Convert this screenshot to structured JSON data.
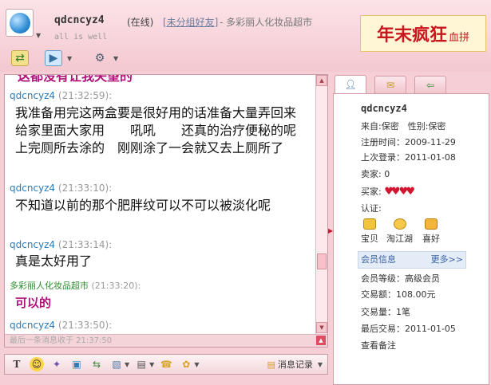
{
  "header": {
    "contact_name": "qdcncyz4",
    "status": "(在线)",
    "group": "[未分组好友]",
    "shop": "- 多彩丽人化妆品超市",
    "signature": "all is well",
    "banner_big": "年末疯狂",
    "banner_small": "血拼"
  },
  "chat": {
    "cut_text": "这都没有让我失望的",
    "messages": [
      {
        "sender": "qdcncyz4",
        "time": "(21:32:59):",
        "text": "我准备用完这两盒要是很好用的话准备大量弄回来　　给家里面大家用　　吼吼　　还真的治疗便秘的呢　　上完厕所去涂的　刚刚涂了一会就又去上厕所了"
      },
      {
        "sender": "qdcncyz4",
        "time": "(21:33:10):",
        "text": "不知道以前的那个肥胖纹可以不可以被淡化呢"
      },
      {
        "sender": "qdcncyz4",
        "time": "(21:33:14):",
        "text": "真是太好用了"
      },
      {
        "sender": "多彩丽人化妆品超市",
        "time": "(21:33:20):",
        "text": "可以的"
      },
      {
        "sender": "qdcncyz4",
        "time": "(21:33:50):",
        "text": ""
      }
    ],
    "last_received": "最后一条消息收于 21:37:50"
  },
  "toolbar_bottom": {
    "history_label": "消息记录"
  },
  "profile": {
    "name": "qdcncyz4",
    "from": "来自:保密　性别:保密",
    "register": "注册时间：2009-11-29",
    "last_login": "上次登录：2011-01-08",
    "seller": "卖家: 0",
    "buyer": "买家:",
    "verify": "认证:",
    "services": [
      "宝贝",
      "淘江湖",
      "喜好"
    ],
    "member_info": "会员信息",
    "more": "更多>>",
    "member_level": "会员等级：高级会员",
    "trade_amount": "交易额：108.00元",
    "trade_count": "交易量：1笔",
    "last_trade": "最后交易：2011-01-05",
    "view_notes": "查看备注"
  },
  "colors": {
    "background": "#f6cfd6",
    "link_blue": "#2a7ab9",
    "shop_green": "#2c8a2c",
    "accent_pink": "#b0127a",
    "banner_red": "#c8171e"
  },
  "icons": [
    "globe-avatar-icon",
    "send-file-icon",
    "video-icon",
    "settings-icon",
    "font-icon",
    "smiley-icon",
    "magic-icon",
    "screenshot-icon",
    "image-icon",
    "shake-icon",
    "save-icon",
    "call-icon",
    "flower-icon",
    "history-icon",
    "person-tab-icon",
    "chat-tab-icon",
    "share-tab-icon"
  ]
}
